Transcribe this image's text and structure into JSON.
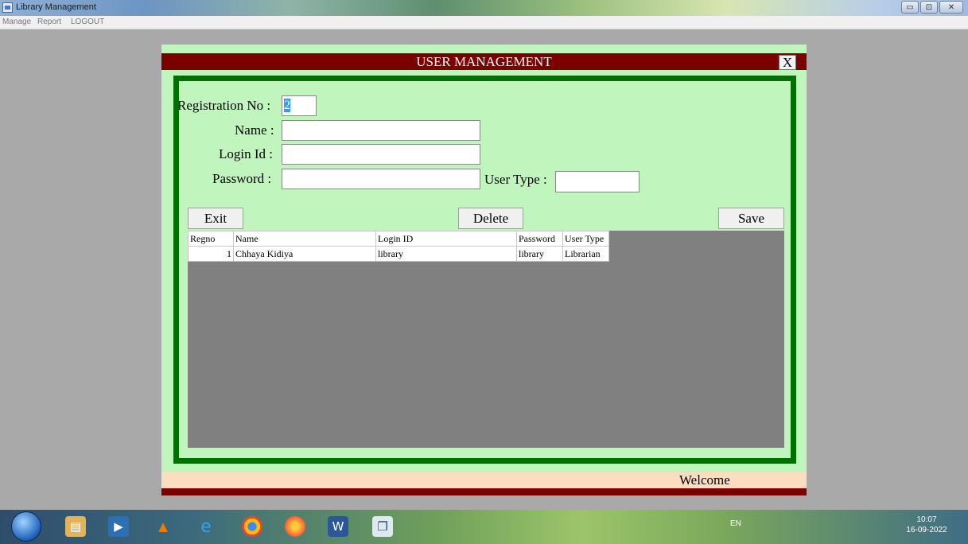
{
  "window": {
    "title": "Library Management",
    "minimize": "▭",
    "maximize": "⊡",
    "close": "✕"
  },
  "menu": [
    "Manage",
    "Report",
    "LOGOUT"
  ],
  "form": {
    "title": "USER MANAGEMENT",
    "close_label": "X",
    "fields": {
      "regno_label": "Registration No :",
      "regno_value": "2",
      "name_label": "Name :",
      "name_value": "",
      "login_label": "Login Id :",
      "login_value": "",
      "password_label": "Password :",
      "password_value": "",
      "usertype_label": "User Type :",
      "usertype_value": ""
    },
    "buttons": {
      "exit": "Exit",
      "delete": "Delete",
      "save": "Save"
    },
    "grid": {
      "columns": [
        "Regno",
        "Name",
        "Login ID",
        "Password",
        "User Type"
      ],
      "rows": [
        [
          "1",
          "Chhaya Kidiya",
          "library",
          "library",
          "Librarian"
        ]
      ]
    },
    "status": "Welcome"
  },
  "taskbar": {
    "language": "EN",
    "time": "10:07",
    "date": "16-09-2022",
    "icons": [
      "start-orb-icon",
      "file-explorer-icon",
      "media-player-icon",
      "vlc-icon",
      "internet-explorer-icon",
      "chrome-icon",
      "firefox-icon",
      "word-icon",
      "app-window-icon"
    ]
  }
}
